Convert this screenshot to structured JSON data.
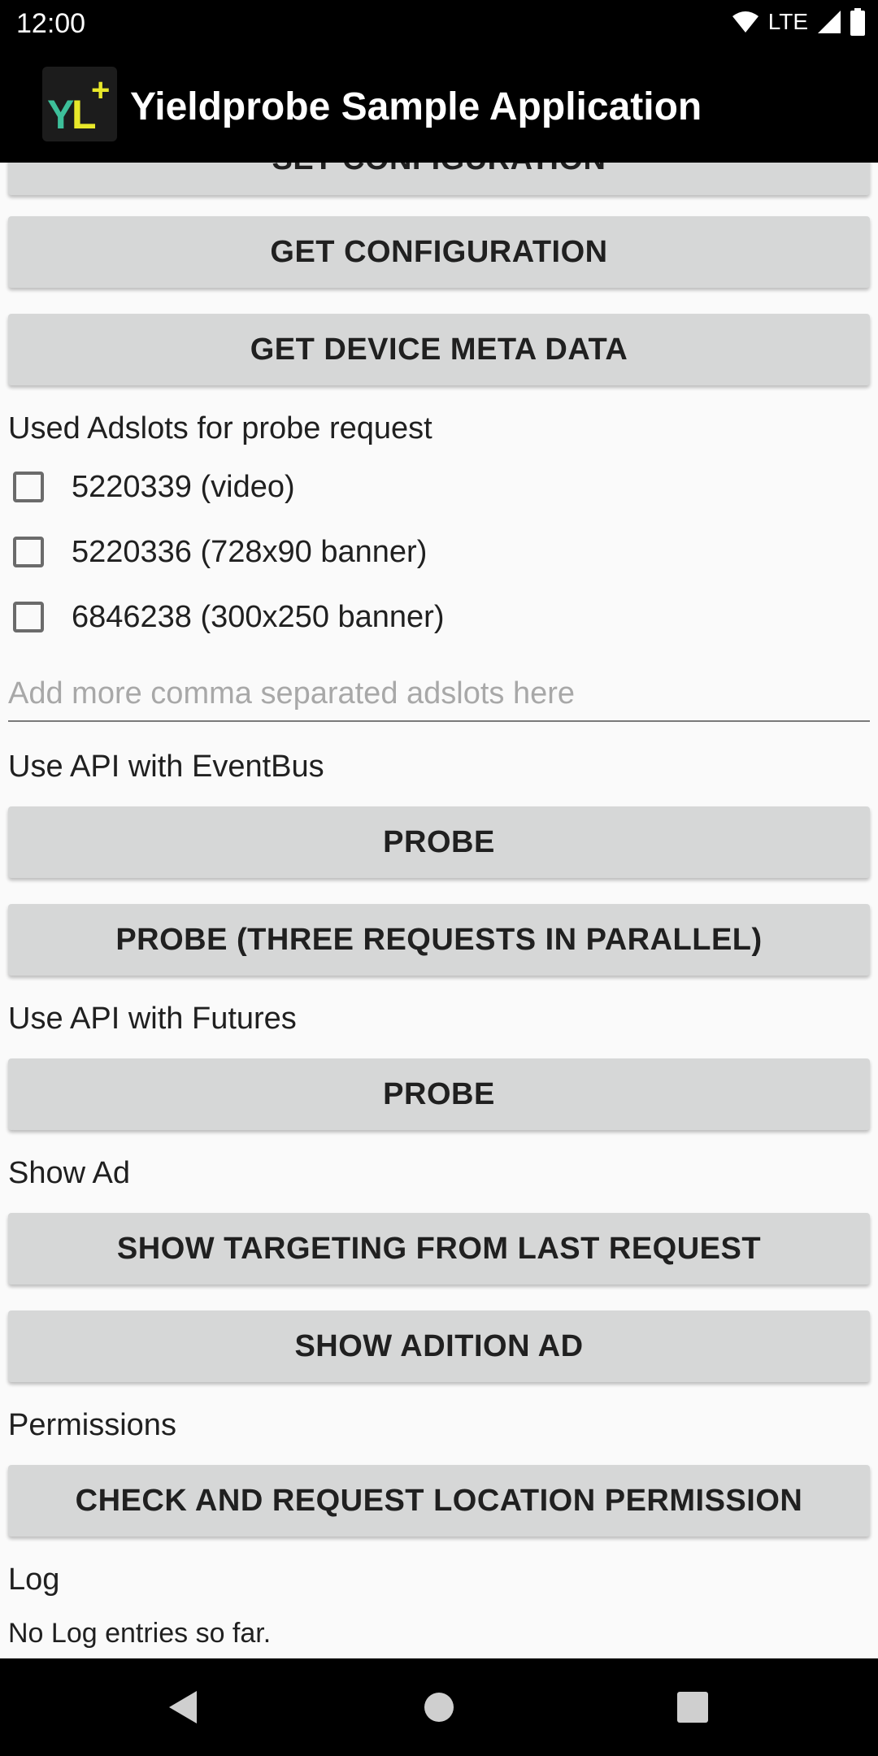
{
  "status_bar": {
    "time": "12:00",
    "network": "LTE",
    "icons": [
      "wifi-icon",
      "signal-icon",
      "battery-icon"
    ]
  },
  "app_bar": {
    "title": "Yieldprobe Sample Application",
    "logo_text": "YL",
    "logo_plus": "+"
  },
  "buttons": {
    "set_configuration": "SET CONFIGURATION",
    "get_configuration": "GET CONFIGURATION",
    "get_device_meta_data": "GET DEVICE META DATA",
    "probe_eventbus": "PROBE",
    "probe_parallel": "PROBE (THREE REQUESTS IN PARALLEL)",
    "probe_futures": "PROBE",
    "show_targeting": "SHOW TARGETING FROM LAST REQUEST",
    "show_adition_ad": "SHOW ADITION AD",
    "check_location_permission": "CHECK AND REQUEST LOCATION PERMISSION"
  },
  "sections": {
    "adslots": "Used Adslots for probe request",
    "eventbus": "Use API with EventBus",
    "futures": "Use API with Futures",
    "show_ad": "Show Ad",
    "permissions": "Permissions",
    "log": "Log"
  },
  "adslots": [
    {
      "label": "5220339 (video)",
      "checked": false
    },
    {
      "label": "5220336 (728x90 banner)",
      "checked": false
    },
    {
      "label": "6846238 (300x250 banner)",
      "checked": false
    }
  ],
  "adslot_input": {
    "placeholder": "Add more comma separated adslots here",
    "value": ""
  },
  "log_text": "No Log entries so far.",
  "colors": {
    "app_bar": "#000000",
    "background": "#fafafa",
    "button": "#d6d7d7",
    "logo_yellow": "#e8e82a",
    "logo_green": "#3dbf9a"
  }
}
